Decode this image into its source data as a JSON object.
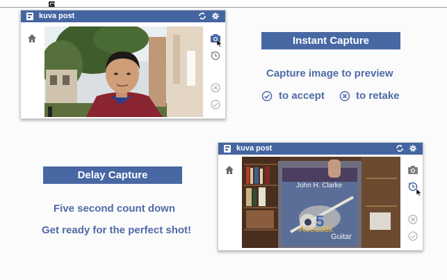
{
  "app": {
    "title": "kuva post"
  },
  "colors": {
    "accent": "#4565a1",
    "caption_text": "#4f6aa6",
    "icon_gray": "#9a9a9a"
  },
  "top_window": {
    "title": "kuva post",
    "icons": [
      "refresh-icon",
      "gear-icon",
      "home-icon",
      "camera-icon",
      "timer-icon",
      "close-circle-icon",
      "check-circle-icon"
    ]
  },
  "bottom_window": {
    "title": "kuva post",
    "icons": [
      "refresh-icon",
      "gear-icon",
      "home-icon",
      "camera-icon",
      "timer-icon",
      "close-circle-icon",
      "check-circle-icon"
    ],
    "album": {
      "artist": "John H. Clarke",
      "title_line1": "Acoustik",
      "title_line2": "Guitar",
      "number": "5"
    }
  },
  "instant": {
    "heading": "Instant Capture",
    "caption": "Capture image to preview",
    "accept": "to accept",
    "retake": "to retake"
  },
  "delay": {
    "heading": "Delay Capture",
    "line1": "Five second count down",
    "line2": "Get ready for the perfect shot!"
  }
}
